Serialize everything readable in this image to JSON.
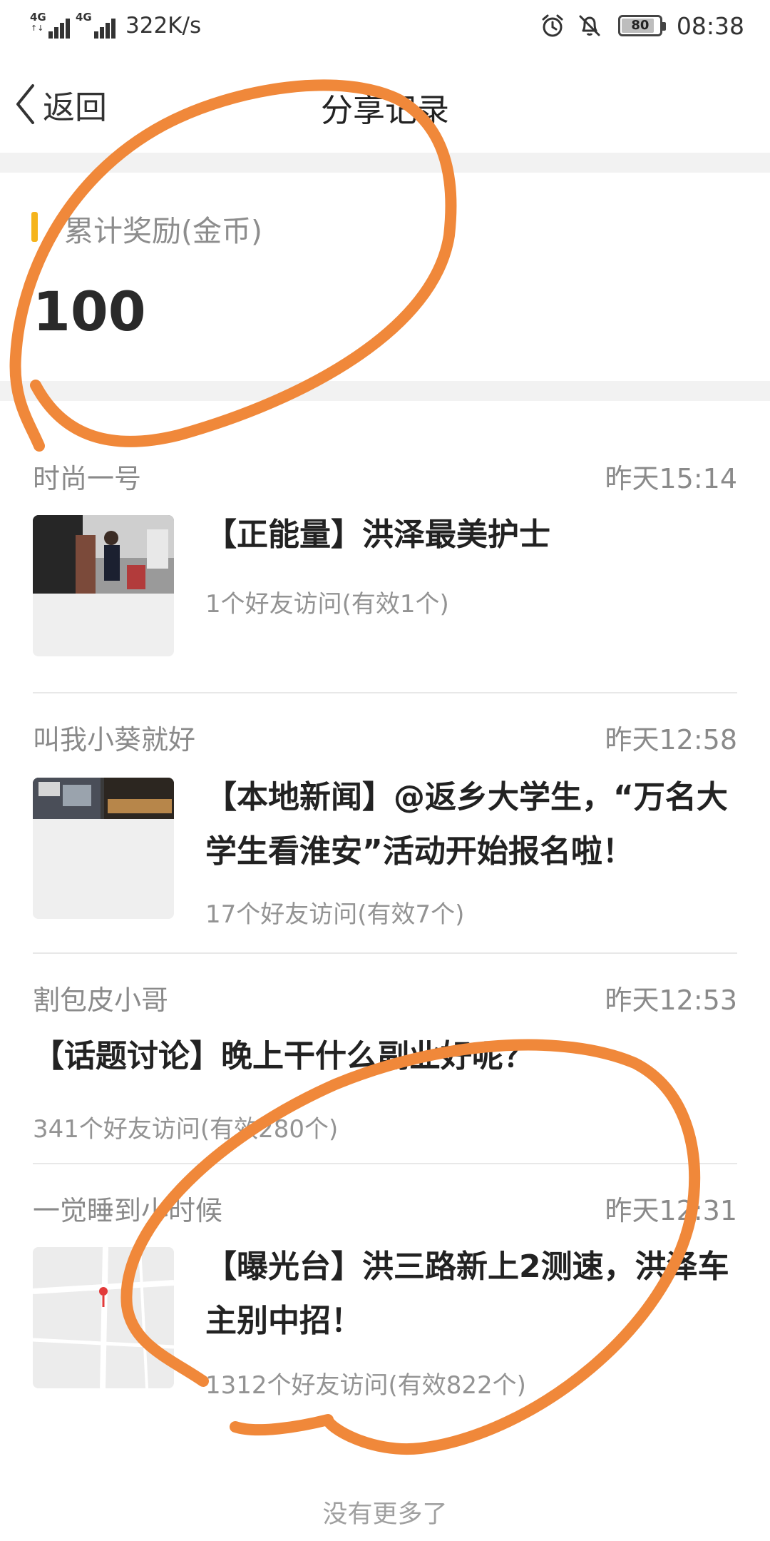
{
  "status_bar": {
    "network_1": "4G",
    "network_2": "4G",
    "speed": "322K/s",
    "battery": "80",
    "time": "08:38",
    "icons": [
      "signal-icon",
      "alarm-icon",
      "mute-bell-icon",
      "battery-icon"
    ]
  },
  "nav": {
    "back_label": "返回",
    "title": "分享记录"
  },
  "reward": {
    "label": "累计奖励(金币)",
    "value": "100"
  },
  "records": [
    {
      "user": "时尚一号",
      "time": "昨天15:14",
      "title": "【正能量】洪泽最美护士",
      "stats": "1个好友访问(有效1个)",
      "has_thumb": true
    },
    {
      "user": "叫我小葵就好",
      "time": "昨天12:58",
      "title": "【本地新闻】@返乡大学生，“万名大学生看淮安”活动开始报名啦！",
      "stats": "17个好友访问(有效7个)",
      "has_thumb": true
    },
    {
      "user": "割包皮小哥",
      "time": "昨天12:53",
      "title": "【话题讨论】晚上干什么副业好呢？",
      "stats": "341个好友访问(有效280个)",
      "has_thumb": false
    },
    {
      "user": "一觉睡到小时候",
      "time": "昨天12:31",
      "title": "【曝光台】洪三路新上2测速，洪泽车主别中招！",
      "stats": "1312个好友访问(有效822个)",
      "has_thumb": true
    }
  ],
  "footer": "没有更多了",
  "colors": {
    "accent_marker": "#f5b41c",
    "annotation": "#f0883a",
    "muted_text": "#8a8a8a",
    "divider": "#e8e8e8"
  }
}
